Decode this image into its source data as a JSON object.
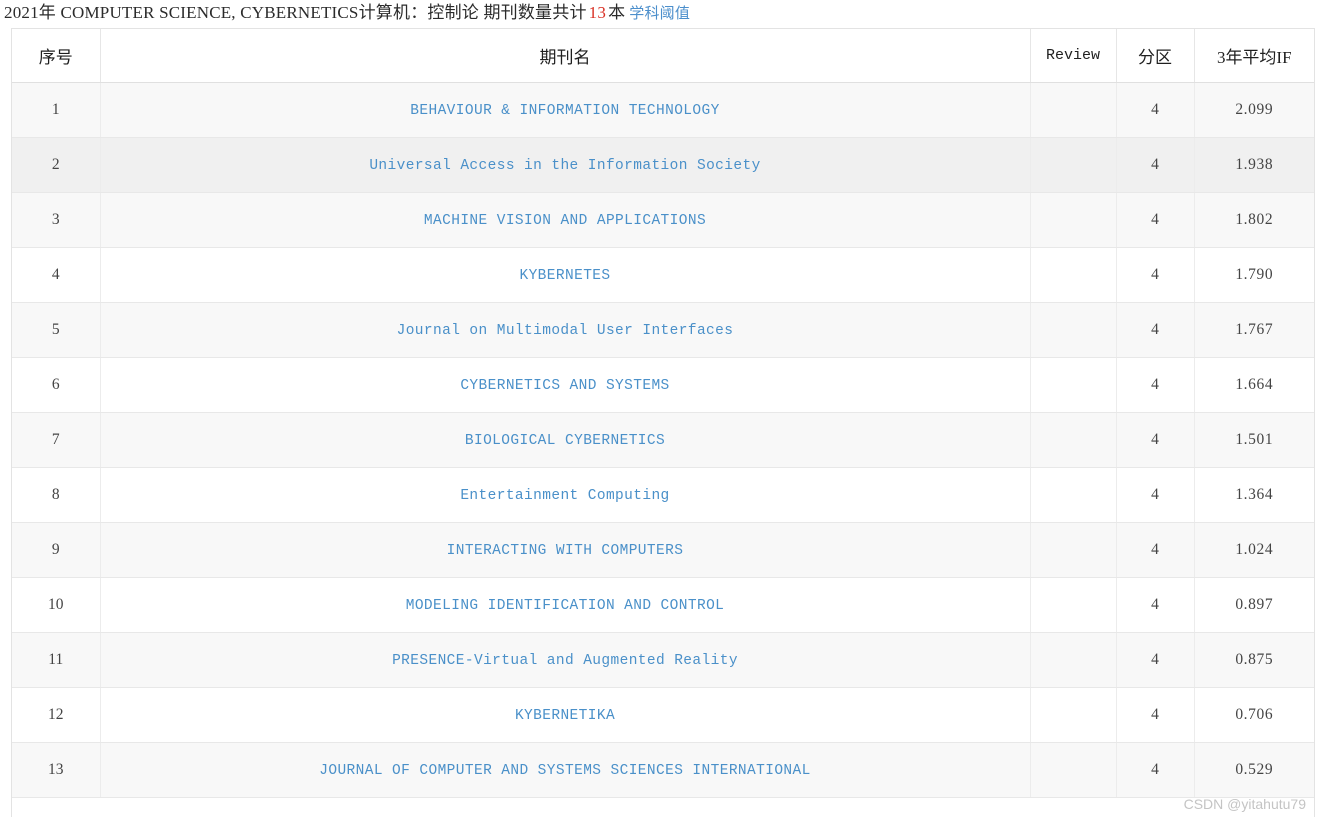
{
  "title": {
    "year_label": "2021年",
    "category_en": "COMPUTER SCIENCE, CYBERNETICS",
    "category_zh": "计算机：控制论",
    "count_label": "期刊数量共计",
    "count": "13",
    "unit": "本",
    "threshold_link": "学科阈值",
    "accent_count_color": "#d93025",
    "link_color": "#4c8fcc"
  },
  "table": {
    "columns": [
      {
        "key": "index",
        "label": "序号"
      },
      {
        "key": "name",
        "label": "期刊名"
      },
      {
        "key": "review",
        "label": "Review"
      },
      {
        "key": "zone",
        "label": "分区"
      },
      {
        "key": "if3",
        "label": "3年平均IF"
      }
    ],
    "rows": [
      {
        "index": "1",
        "name": "BEHAVIOUR & INFORMATION TECHNOLOGY",
        "review": "",
        "zone": "4",
        "if3": "2.099",
        "shade": "light"
      },
      {
        "index": "2",
        "name": "Universal Access in the Information Society",
        "review": "",
        "zone": "4",
        "if3": "1.938",
        "shade": "hover"
      },
      {
        "index": "3",
        "name": "MACHINE VISION AND APPLICATIONS",
        "review": "",
        "zone": "4",
        "if3": "1.802",
        "shade": "light"
      },
      {
        "index": "4",
        "name": "KYBERNETES",
        "review": "",
        "zone": "4",
        "if3": "1.790",
        "shade": "white"
      },
      {
        "index": "5",
        "name": "Journal on Multimodal User Interfaces",
        "review": "",
        "zone": "4",
        "if3": "1.767",
        "shade": "light"
      },
      {
        "index": "6",
        "name": "CYBERNETICS AND SYSTEMS",
        "review": "",
        "zone": "4",
        "if3": "1.664",
        "shade": "white"
      },
      {
        "index": "7",
        "name": "BIOLOGICAL CYBERNETICS",
        "review": "",
        "zone": "4",
        "if3": "1.501",
        "shade": "light"
      },
      {
        "index": "8",
        "name": "Entertainment Computing",
        "review": "",
        "zone": "4",
        "if3": "1.364",
        "shade": "white"
      },
      {
        "index": "9",
        "name": "INTERACTING WITH COMPUTERS",
        "review": "",
        "zone": "4",
        "if3": "1.024",
        "shade": "light"
      },
      {
        "index": "10",
        "name": "MODELING IDENTIFICATION AND CONTROL",
        "review": "",
        "zone": "4",
        "if3": "0.897",
        "shade": "white"
      },
      {
        "index": "11",
        "name": "PRESENCE-Virtual and Augmented Reality",
        "review": "",
        "zone": "4",
        "if3": "0.875",
        "shade": "light"
      },
      {
        "index": "12",
        "name": "KYBERNETIKA",
        "review": "",
        "zone": "4",
        "if3": "0.706",
        "shade": "white"
      },
      {
        "index": "13",
        "name": "JOURNAL OF COMPUTER AND SYSTEMS SCIENCES INTERNATIONAL",
        "review": "",
        "zone": "4",
        "if3": "0.529",
        "shade": "light"
      }
    ]
  },
  "watermark": "CSDN @yitahutu79"
}
